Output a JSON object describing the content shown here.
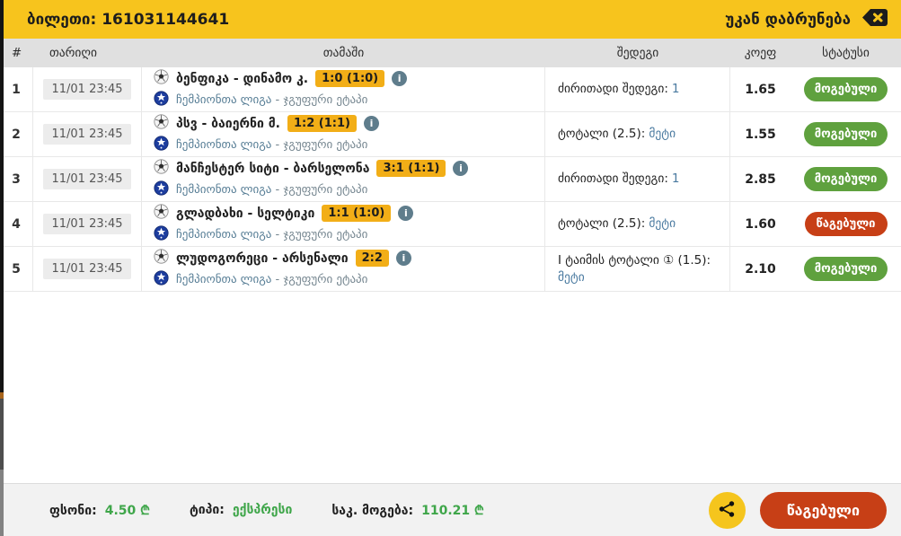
{
  "colors": {
    "accent_yellow": "#f7c41d",
    "badge_yellow": "#f2ae17",
    "won_green": "#5fa13e",
    "lost_red": "#c73f16",
    "value_green": "#3fa64a",
    "pick_blue": "#4a7aa0",
    "league_blue": "#567d95",
    "table_header_gray": "#e0e0e0"
  },
  "topbar": {
    "title": "ბილეთი: 161031144641",
    "back_label": "უკან დაბრუნება"
  },
  "icons": {
    "back": "backspace-icon",
    "info": "i",
    "share": "share-nodes-icon",
    "ball": "soccer-ball-icon",
    "league_ball": "champions-league-ball-icon"
  },
  "table": {
    "headers": {
      "num": "#",
      "date": "თარიღი",
      "game": "თამაში",
      "result": "შედეგი",
      "coef": "კოეფ",
      "status": "სტატუსი"
    },
    "rows": [
      {
        "num": "1",
        "date": "11/01 23:45",
        "teams": "ბენფიკა - დინამო კ.",
        "score": "1:0 (1:0)",
        "league": "ჩემპიონთა ლიგა",
        "stage": " - ჯგუფური ეტაპი",
        "bet": "ძირითადი შედეგი:",
        "pick": "1",
        "coef": "1.65",
        "status": "მოგებული",
        "status_type": "won"
      },
      {
        "num": "2",
        "date": "11/01 23:45",
        "teams": "პსვ - ბაიერნი მ.",
        "score": "1:2 (1:1)",
        "league": "ჩემპიონთა ლიგა",
        "stage": " - ჯგუფური ეტაპი",
        "bet": "ტოტალი (2.5):",
        "pick": "მეტი",
        "coef": "1.55",
        "status": "მოგებული",
        "status_type": "won"
      },
      {
        "num": "3",
        "date": "11/01 23:45",
        "teams": "მანჩესტერ სიტი - ბარსელონა",
        "score": "3:1 (1:1)",
        "league": "ჩემპიონთა ლიგა",
        "stage": " - ჯგუფური ეტაპი",
        "bet": "ძირითადი შედეგი:",
        "pick": "1",
        "coef": "2.85",
        "status": "მოგებული",
        "status_type": "won"
      },
      {
        "num": "4",
        "date": "11/01 23:45",
        "teams": "გლადბახი - სელტიკი",
        "score": "1:1 (1:0)",
        "league": "ჩემპიონთა ლიგა",
        "stage": " - ჯგუფური ეტაპი",
        "bet": "ტოტალი (2.5):",
        "pick": "მეტი",
        "coef": "1.60",
        "status": "წაგებული",
        "status_type": "lost"
      },
      {
        "num": "5",
        "date": "11/01 23:45",
        "teams": "ლუდოგორეცი - არსენალი",
        "score": "2:2",
        "league": "ჩემპიონთა ლიგა",
        "stage": " - ჯგუფური ეტაპი",
        "bet": "I ტაიმის ტოტალი ① (1.5):",
        "pick": "მეტი",
        "coef": "2.10",
        "status": "მოგებული",
        "status_type": "won"
      }
    ]
  },
  "footer": {
    "stake_label": "ფსონი:",
    "stake_value": "4.50 ₾",
    "type_label": "ტიპი:",
    "type_value": "ექსპრესი",
    "payout_label": "საკ. მოგება:",
    "payout_value": "110.21 ₾",
    "button_label": "წაგებული"
  }
}
